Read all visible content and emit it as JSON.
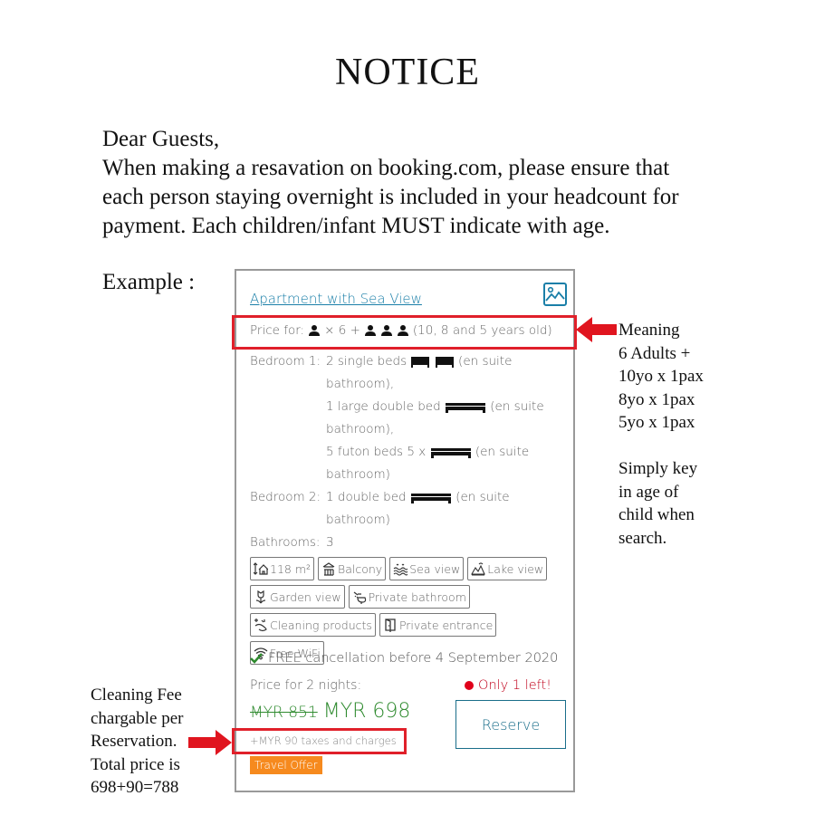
{
  "title": "NOTICE",
  "intro": {
    "greeting": "Dear Guests,",
    "line1": "When making a resavation on booking.com, please ensure that",
    "line2": "each person staying overnight is included in your headcount for",
    "line3": "payment. Each children/infant MUST indicate with age."
  },
  "example_label": "Example :",
  "card": {
    "room_name": "Apartment with Sea View",
    "price_for_label": "Price for:",
    "adults_multiplier": "× 6 +",
    "children_ages": "(10, 8 and 5 years old)",
    "bedrooms": [
      {
        "label": "Bedroom 1:",
        "lines": [
          "2 single beds",
          "(en suite",
          "bathroom),",
          "1 large double bed",
          "(en suite",
          "bathroom),",
          "5 futon beds 5 x",
          "(en suite",
          "bathroom)"
        ]
      },
      {
        "label": "Bedroom 2:",
        "lines": [
          "1 double bed",
          "(en suite",
          "bathroom)"
        ]
      }
    ],
    "bathrooms_label": "Bathrooms:",
    "bathrooms_value": "3",
    "facilities": [
      {
        "icon": "area-icon",
        "label": "118 m²"
      },
      {
        "icon": "balcony-icon",
        "label": "Balcony"
      },
      {
        "icon": "sea-view-icon",
        "label": "Sea view"
      },
      {
        "icon": "lake-view-icon",
        "label": "Lake view"
      },
      {
        "icon": "garden-view-icon",
        "label": "Garden view"
      },
      {
        "icon": "private-bathroom-icon",
        "label": "Private bathroom"
      },
      {
        "icon": "cleaning-products-icon",
        "label": "Cleaning products"
      },
      {
        "icon": "private-entrance-icon",
        "label": "Private entrance"
      },
      {
        "icon": "wifi-icon",
        "label": "Free WiFi"
      }
    ],
    "cancellation": "FREE cancellation before 4 September 2020",
    "price_for_nights": "Price for 2 nights:",
    "availability": "Only 1 left!",
    "old_price": "MYR 851",
    "new_price": "MYR 698",
    "taxes": "+MYR 90 taxes and charges",
    "offer_badge": "Travel Offer",
    "reserve_label": "Reserve"
  },
  "annotations": {
    "meaning": [
      "Meaning",
      "6 Adults +",
      "10yo x 1pax",
      "8yo x 1pax",
      "5yo x 1pax",
      "",
      "Simply key",
      "in age of",
      "child when",
      "search."
    ],
    "cleaning": [
      "Cleaning Fee",
      "chargable per",
      "Reservation.",
      "Total price is",
      "698+90=788"
    ]
  },
  "colors": {
    "highlight": "#e0202a",
    "link": "#1a7fa8",
    "price_green": "#2e8a2e",
    "offer_orange": "#f68a1e",
    "reserve_blue": "#1a6e8a"
  }
}
